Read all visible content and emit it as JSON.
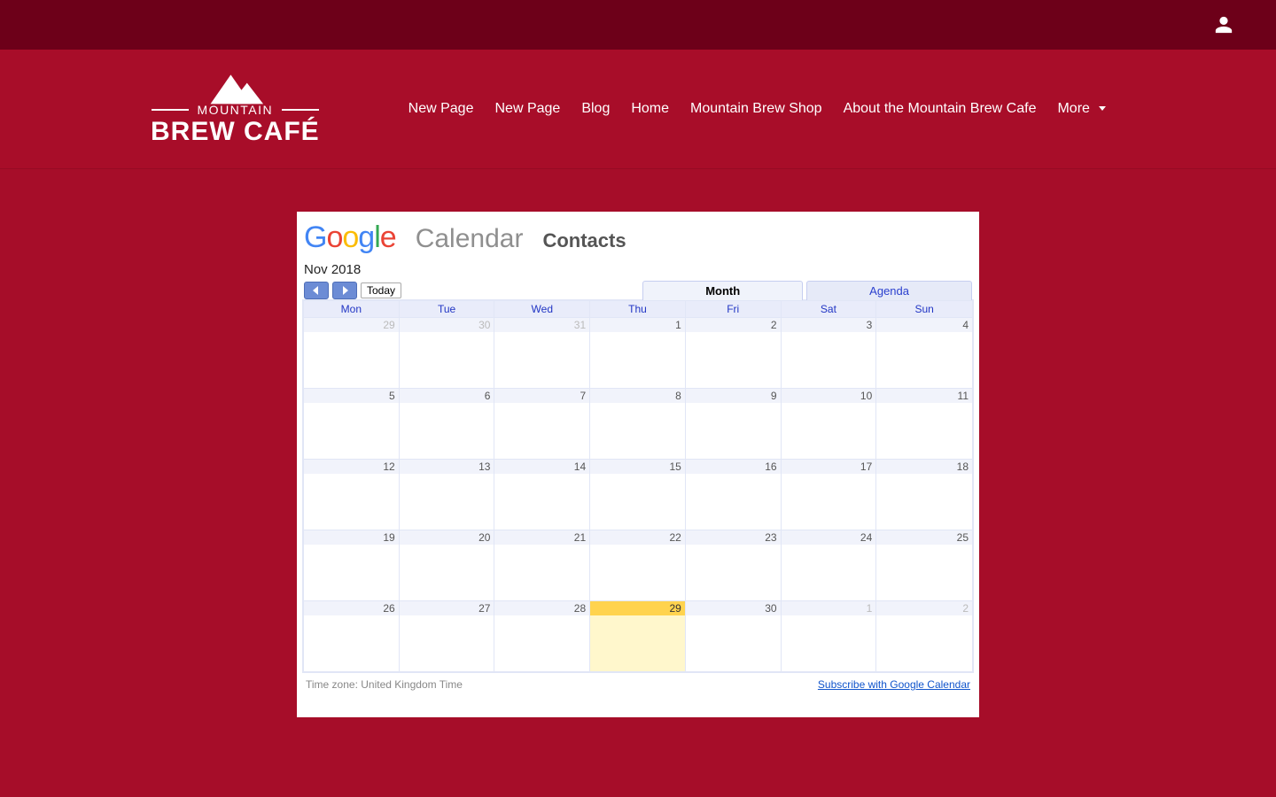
{
  "nav": {
    "items": [
      "New Page",
      "New Page",
      "Blog",
      "Home",
      "Mountain Brew Shop",
      "About the Mountain Brew Cafe"
    ],
    "more_label": "More"
  },
  "logo": {
    "line1": "MOUNTAIN",
    "line2": "BREW CAFÉ"
  },
  "calendar": {
    "brand_calendar": "Calendar",
    "brand_contacts": "Contacts",
    "month_label": "Nov 2018",
    "today_btn": "Today",
    "view_month": "Month",
    "view_agenda": "Agenda",
    "dow": [
      "Mon",
      "Tue",
      "Wed",
      "Thu",
      "Fri",
      "Sat",
      "Sun"
    ],
    "weeks": [
      [
        {
          "n": "29",
          "out": true
        },
        {
          "n": "30",
          "out": true
        },
        {
          "n": "31",
          "out": true
        },
        {
          "n": "1"
        },
        {
          "n": "2"
        },
        {
          "n": "3"
        },
        {
          "n": "4"
        }
      ],
      [
        {
          "n": "5"
        },
        {
          "n": "6"
        },
        {
          "n": "7"
        },
        {
          "n": "8"
        },
        {
          "n": "9"
        },
        {
          "n": "10"
        },
        {
          "n": "11"
        }
      ],
      [
        {
          "n": "12"
        },
        {
          "n": "13"
        },
        {
          "n": "14"
        },
        {
          "n": "15"
        },
        {
          "n": "16"
        },
        {
          "n": "17"
        },
        {
          "n": "18"
        }
      ],
      [
        {
          "n": "19"
        },
        {
          "n": "20"
        },
        {
          "n": "21"
        },
        {
          "n": "22"
        },
        {
          "n": "23"
        },
        {
          "n": "24"
        },
        {
          "n": "25"
        }
      ],
      [
        {
          "n": "26"
        },
        {
          "n": "27"
        },
        {
          "n": "28"
        },
        {
          "n": "29",
          "today": true
        },
        {
          "n": "30"
        },
        {
          "n": "1",
          "out": true
        },
        {
          "n": "2",
          "out": true
        }
      ]
    ],
    "timezone_label": "Time zone: United Kingdom Time",
    "subscribe_label": "Subscribe with Google Calendar"
  }
}
